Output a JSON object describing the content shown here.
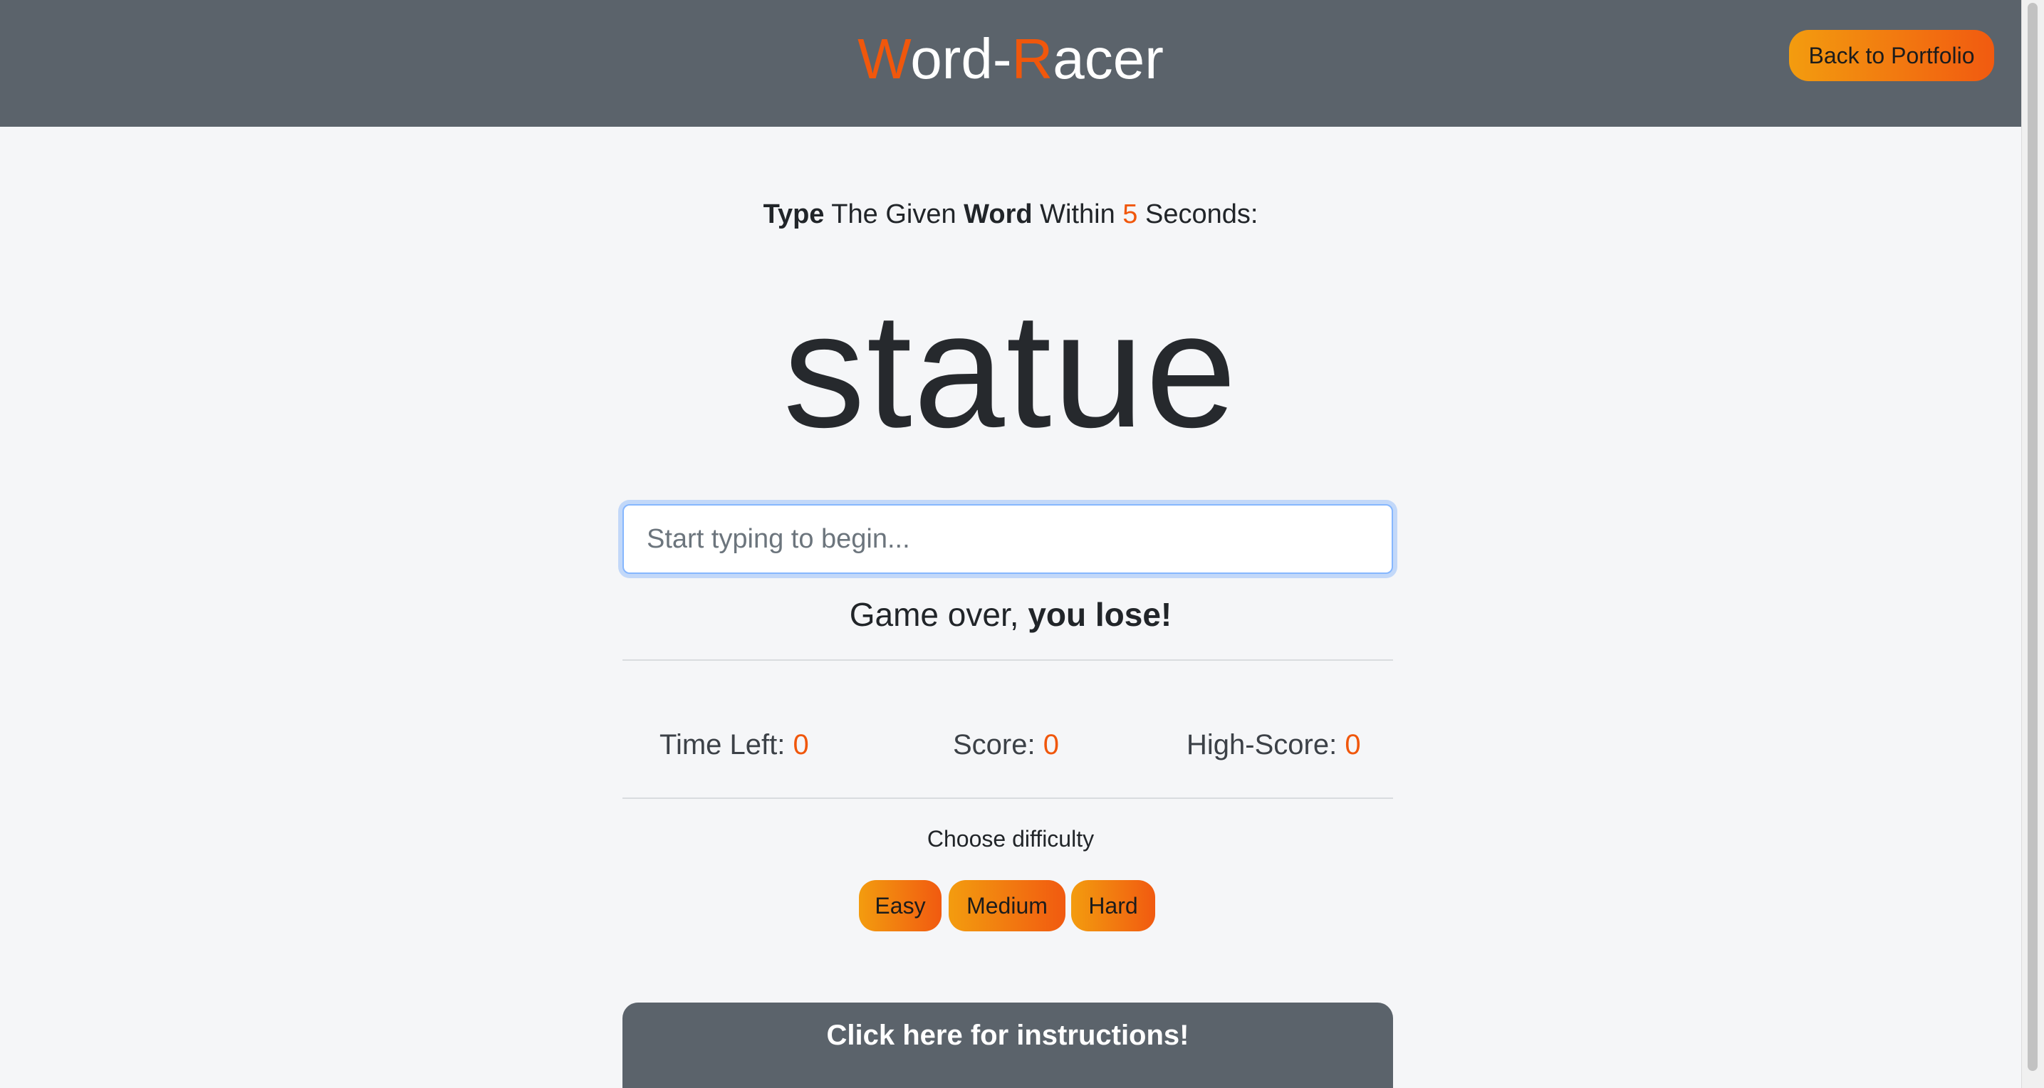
{
  "header": {
    "brand_w": "W",
    "brand_ord": "ord-",
    "brand_r": "R",
    "brand_acer": "acer",
    "back_button": "Back to Portfolio"
  },
  "instruction": {
    "type": "Type",
    "the_given": " The Given ",
    "word": "Word",
    "within": " Within ",
    "seconds_value": "5",
    "seconds_label": " Seconds:"
  },
  "current_word": "statue",
  "input": {
    "value": "",
    "placeholder": "Start typing to begin..."
  },
  "message": {
    "prefix": "Game over, ",
    "emphasis": "you lose!"
  },
  "stats": {
    "time_left_label": "Time Left: ",
    "time_left_value": "0",
    "score_label": "Score: ",
    "score_value": "0",
    "high_score_label": "High-Score: ",
    "high_score_value": "0"
  },
  "difficulty": {
    "label": "Choose difficulty",
    "options": [
      "Easy",
      "Medium",
      "Hard"
    ]
  },
  "instructions_button": "Click here for instructions!",
  "colors": {
    "accent": "#f0570c",
    "header_bg": "#5b636b",
    "button_gradient_start": "#f39c0f",
    "button_gradient_end": "#f15a10"
  }
}
